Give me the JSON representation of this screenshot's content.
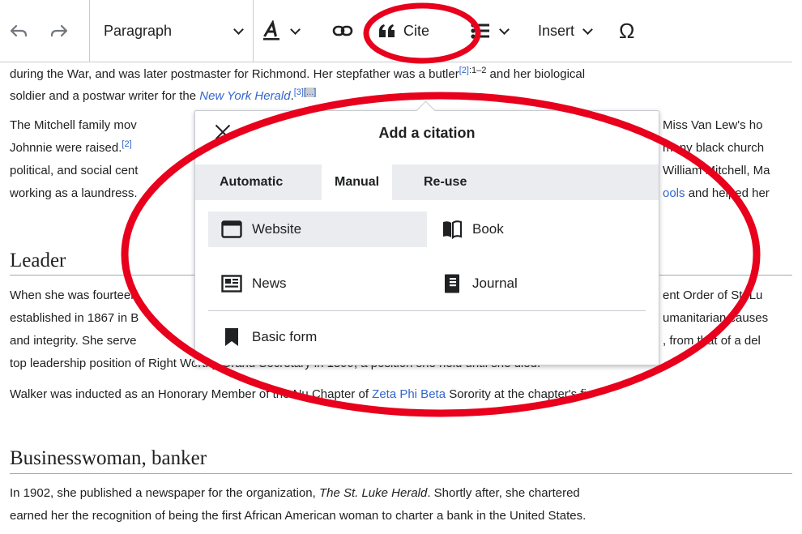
{
  "toolbar": {
    "paragraph_label": "Paragraph",
    "cite_label": "Cite",
    "insert_label": "Insert",
    "omega_label": "Ω"
  },
  "article": {
    "line1_a": "during the War, and was later postmaster for Richmond. Her stepfather was a butler",
    "line1_ref": "[2]",
    "line1_ref_pages": ":1–2",
    "line1_b": " and her biological",
    "line2_a": "soldier and a postwar writer for the ",
    "line2_link": "New York Herald",
    "line2_ref": "[3]",
    "line2_ref_tag": "[...]",
    "line3_a": "The Mitchell family mov",
    "line3_b": "Miss Van Lew's ho",
    "line4_a": "Johnnie were raised.",
    "line4_ref": "[2]",
    "line4_b": "many black church",
    "line5_a": "political, and social cent",
    "line5_b": "William Mitchell, Ma",
    "line6_a": "working as a laundress.",
    "line6_link": "ools",
    "line6_b": " and helped her",
    "heading_leader": "Leader",
    "line7_a": "When she was fourteen",
    "line7_b": "ent Order of St. Lu",
    "line8_a": "established in 1867 in B",
    "line8_b": "umanitarian causes",
    "line9_a": "and integrity. She serve",
    "line9_b": ", from that of a del",
    "line10": "top leadership position of Right Worthy Grand Secretary in 1899, a position she held until she died.",
    "line11_a": "Walker was inducted as an Honorary Member of the Nu Chapter of ",
    "line11_link": "Zeta Phi Beta",
    "line11_b": " Sorority at the chapter's fi",
    "heading_business": "Businesswoman, banker",
    "line12_a": "In 1902, she published a newspaper for the organization, ",
    "line12_italic": "The St. Luke Herald",
    "line12_b": ".  Shortly after, she chartered",
    "line13": "earned her the recognition of being the first African American woman to charter a bank in the United States."
  },
  "dialog": {
    "title": "Add a citation",
    "tabs": [
      "Automatic",
      "Manual",
      "Re-use"
    ],
    "active_tab": "Manual",
    "options": {
      "website": "Website",
      "book": "Book",
      "news": "News",
      "journal": "Journal",
      "basic": "Basic form"
    }
  },
  "icons": {
    "undo": "undo-icon",
    "redo": "redo-icon",
    "text_style": "text-style-icon",
    "link": "link-icon",
    "cite": "quote-icon",
    "list": "list-icon",
    "close": "close-icon"
  },
  "colors": {
    "annotation": "#e8001c",
    "link": "#3366cc",
    "highlight": "#eaecf0"
  }
}
